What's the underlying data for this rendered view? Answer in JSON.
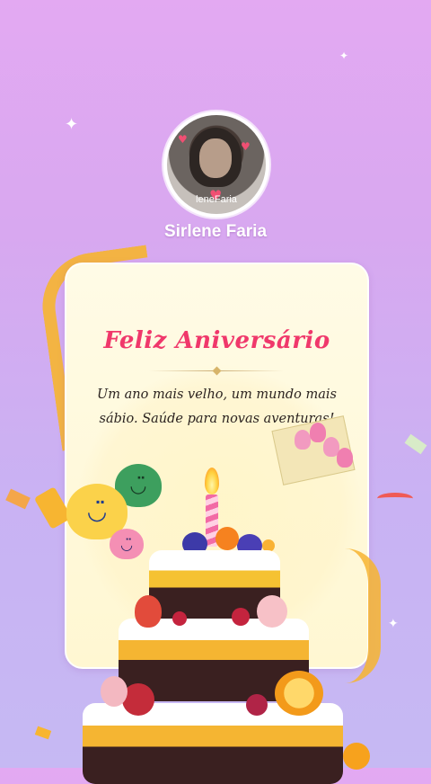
{
  "profile": {
    "username": "Sirlene Faria",
    "avatar_watermark": "leneFaria"
  },
  "card": {
    "title": "Feliz Aniversário",
    "message_line1": "Um ano mais velho, um mundo mais",
    "message_line2": "sábio. Saúde para novas aventuras!"
  },
  "icons": {
    "sparkle": "four-point-star",
    "smiley": "smiley-face",
    "cake": "birthday-cake",
    "envelope": "flower-envelope"
  },
  "colors": {
    "background_top": "#e3a9f2",
    "background_bottom": "#c6b9f3",
    "title": "#f0386b",
    "card": "#fff8dc",
    "ribbon": "#f7b531"
  }
}
